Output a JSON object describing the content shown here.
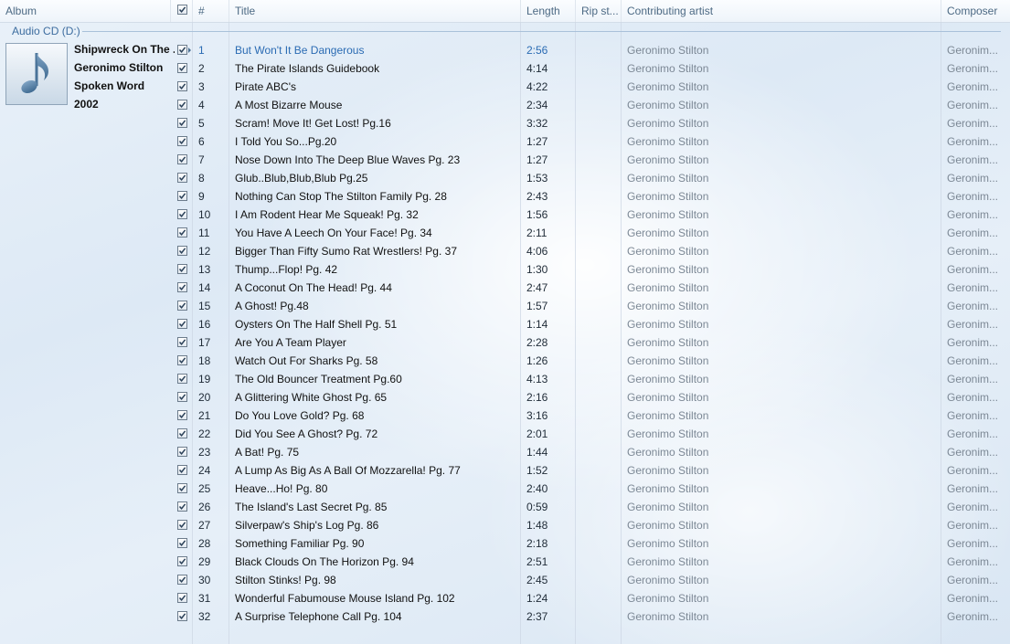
{
  "header": {
    "columns": {
      "album": "Album",
      "num": "#",
      "title": "Title",
      "length": "Length",
      "rip": "Rip st...",
      "artist": "Contributing artist",
      "composer": "Composer"
    }
  },
  "group": {
    "label": "Audio CD (D:)"
  },
  "album": {
    "name": "Shipwreck On The ...",
    "artist": "Geronimo Stilton",
    "genre": "Spoken Word",
    "year": "2002",
    "art_icon": "music-note-icon"
  },
  "colors": {
    "accent": "#2a6bb3",
    "header_text": "#4d6a84",
    "group_text": "#3d6d9f",
    "muted": "#7c8895"
  },
  "tracks": [
    {
      "num": "1",
      "title": "But Won't It Be Dangerous",
      "length": "2:56",
      "artist": "Geronimo Stilton",
      "composer": "Geronim..."
    },
    {
      "num": "2",
      "title": "The Pirate Islands Guidebook",
      "length": "4:14",
      "artist": "Geronimo Stilton",
      "composer": "Geronim..."
    },
    {
      "num": "3",
      "title": "Pirate ABC's",
      "length": "4:22",
      "artist": "Geronimo Stilton",
      "composer": "Geronim..."
    },
    {
      "num": "4",
      "title": "A Most Bizarre Mouse",
      "length": "2:34",
      "artist": "Geronimo Stilton",
      "composer": "Geronim..."
    },
    {
      "num": "5",
      "title": "Scram! Move It! Get Lost! Pg.16",
      "length": "3:32",
      "artist": "Geronimo Stilton",
      "composer": "Geronim..."
    },
    {
      "num": "6",
      "title": "I Told You So...Pg.20",
      "length": "1:27",
      "artist": "Geronimo Stilton",
      "composer": "Geronim..."
    },
    {
      "num": "7",
      "title": "Nose Down Into The Deep Blue Waves Pg. 23",
      "length": "1:27",
      "artist": "Geronimo Stilton",
      "composer": "Geronim..."
    },
    {
      "num": "8",
      "title": "Glub..Blub,Blub,Blub Pg.25",
      "length": "1:53",
      "artist": "Geronimo Stilton",
      "composer": "Geronim..."
    },
    {
      "num": "9",
      "title": "Nothing Can Stop The Stilton Family Pg. 28",
      "length": "2:43",
      "artist": "Geronimo Stilton",
      "composer": "Geronim..."
    },
    {
      "num": "10",
      "title": "I Am Rodent Hear Me Squeak! Pg. 32",
      "length": "1:56",
      "artist": "Geronimo Stilton",
      "composer": "Geronim..."
    },
    {
      "num": "11",
      "title": "You Have A Leech On Your Face! Pg. 34",
      "length": "2:11",
      "artist": "Geronimo Stilton",
      "composer": "Geronim..."
    },
    {
      "num": "12",
      "title": "Bigger Than Fifty Sumo Rat Wrestlers! Pg. 37",
      "length": "4:06",
      "artist": "Geronimo Stilton",
      "composer": "Geronim..."
    },
    {
      "num": "13",
      "title": "Thump...Flop! Pg. 42",
      "length": "1:30",
      "artist": "Geronimo Stilton",
      "composer": "Geronim..."
    },
    {
      "num": "14",
      "title": "A Coconut On The Head! Pg. 44",
      "length": "2:47",
      "artist": "Geronimo Stilton",
      "composer": "Geronim..."
    },
    {
      "num": "15",
      "title": "A Ghost! Pg.48",
      "length": "1:57",
      "artist": "Geronimo Stilton",
      "composer": "Geronim..."
    },
    {
      "num": "16",
      "title": "Oysters On The Half Shell Pg. 51",
      "length": "1:14",
      "artist": "Geronimo Stilton",
      "composer": "Geronim..."
    },
    {
      "num": "17",
      "title": "Are You A Team Player",
      "length": "2:28",
      "artist": "Geronimo Stilton",
      "composer": "Geronim..."
    },
    {
      "num": "18",
      "title": "Watch Out For Sharks Pg. 58",
      "length": "1:26",
      "artist": "Geronimo Stilton",
      "composer": "Geronim..."
    },
    {
      "num": "19",
      "title": "The Old Bouncer Treatment Pg.60",
      "length": "4:13",
      "artist": "Geronimo Stilton",
      "composer": "Geronim..."
    },
    {
      "num": "20",
      "title": "A Glittering White Ghost Pg. 65",
      "length": "2:16",
      "artist": "Geronimo Stilton",
      "composer": "Geronim..."
    },
    {
      "num": "21",
      "title": "Do You Love Gold? Pg. 68",
      "length": "3:16",
      "artist": "Geronimo Stilton",
      "composer": "Geronim..."
    },
    {
      "num": "22",
      "title": "Did You See A Ghost? Pg. 72",
      "length": "2:01",
      "artist": "Geronimo Stilton",
      "composer": "Geronim..."
    },
    {
      "num": "23",
      "title": "A Bat! Pg. 75",
      "length": "1:44",
      "artist": "Geronimo Stilton",
      "composer": "Geronim..."
    },
    {
      "num": "24",
      "title": "A Lump As Big As A Ball Of Mozzarella! Pg. 77",
      "length": "1:52",
      "artist": "Geronimo Stilton",
      "composer": "Geronim..."
    },
    {
      "num": "25",
      "title": "Heave...Ho! Pg. 80",
      "length": "2:40",
      "artist": "Geronimo Stilton",
      "composer": "Geronim..."
    },
    {
      "num": "26",
      "title": "The Island's Last Secret Pg. 85",
      "length": "0:59",
      "artist": "Geronimo Stilton",
      "composer": "Geronim..."
    },
    {
      "num": "27",
      "title": "Silverpaw's Ship's Log Pg. 86",
      "length": "1:48",
      "artist": "Geronimo Stilton",
      "composer": "Geronim..."
    },
    {
      "num": "28",
      "title": "Something Familiar Pg. 90",
      "length": "2:18",
      "artist": "Geronimo Stilton",
      "composer": "Geronim..."
    },
    {
      "num": "29",
      "title": "Black Clouds On The Horizon Pg. 94",
      "length": "2:51",
      "artist": "Geronimo Stilton",
      "composer": "Geronim..."
    },
    {
      "num": "30",
      "title": "Stilton Stinks! Pg. 98",
      "length": "2:45",
      "artist": "Geronimo Stilton",
      "composer": "Geronim..."
    },
    {
      "num": "31",
      "title": "Wonderful Fabumouse Mouse Island Pg. 102",
      "length": "1:24",
      "artist": "Geronimo Stilton",
      "composer": "Geronim..."
    },
    {
      "num": "32",
      "title": "A Surprise Telephone Call Pg. 104",
      "length": "2:37",
      "artist": "Geronimo Stilton",
      "composer": "Geronim..."
    }
  ]
}
